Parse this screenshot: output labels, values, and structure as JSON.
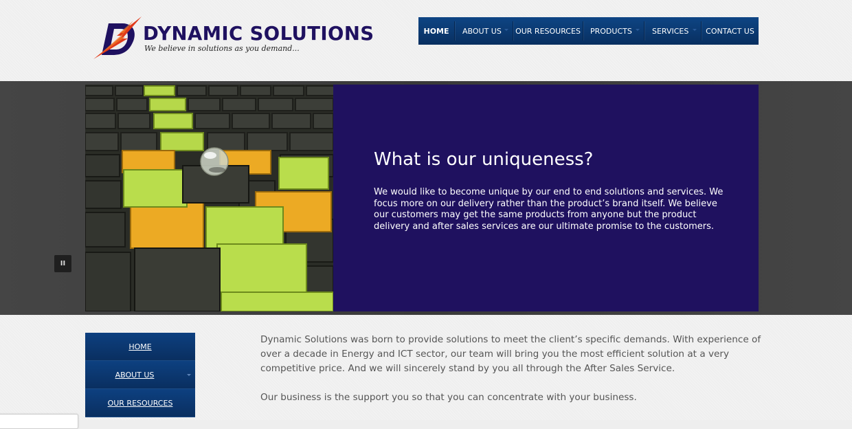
{
  "header": {
    "logo": {
      "mark": "D",
      "name": "DYNAMIC SOLUTIONS",
      "tagline": "We believe in solutions as you demand...",
      "colors": {
        "name": "#1f1160",
        "bolt": "#e03a1a"
      }
    },
    "nav": [
      {
        "label": "HOME",
        "active": true,
        "has_submenu": false
      },
      {
        "label": "ABOUT US",
        "active": false,
        "has_submenu": true
      },
      {
        "label": "OUR RESOURCES",
        "active": false,
        "has_submenu": false
      },
      {
        "label": "PRODUCTS",
        "active": false,
        "has_submenu": true
      },
      {
        "label": "SERVICES",
        "active": false,
        "has_submenu": true
      },
      {
        "label": "CONTACT US",
        "active": false,
        "has_submenu": false
      }
    ]
  },
  "slider": {
    "title": "What is our uniqueness?",
    "text": "We would like to become unique by our end to end solutions and services. We focus more on our delivery rather than the product’s brand itself. We believe our customers may get the same products from anyone but the product delivery and after sales services are our ultimate promise to the customers.",
    "pause_label": "II",
    "panel_color": "#1f115f",
    "image_icon": "green-cubes-image"
  },
  "sidebar": {
    "items": [
      {
        "label": "HOME",
        "has_submenu": false
      },
      {
        "label": "ABOUT US",
        "has_submenu": true
      },
      {
        "label": "OUR RESOURCES",
        "has_submenu": false
      }
    ]
  },
  "content": {
    "paragraphs": [
      "Dynamic Solutions was born to provide solutions to meet the client’s specific demands. With experience of over a decade in Energy and ICT sector, our team will bring you the most efficient solution at a very competitive price. And we will sincerely stand by you all through the After Sales Service.",
      "Our business is the support you so that you can concentrate with your business."
    ]
  },
  "colors": {
    "nav_blue": "#0b3a73",
    "band_gray": "#3d3d3d",
    "body_text": "#555555"
  }
}
